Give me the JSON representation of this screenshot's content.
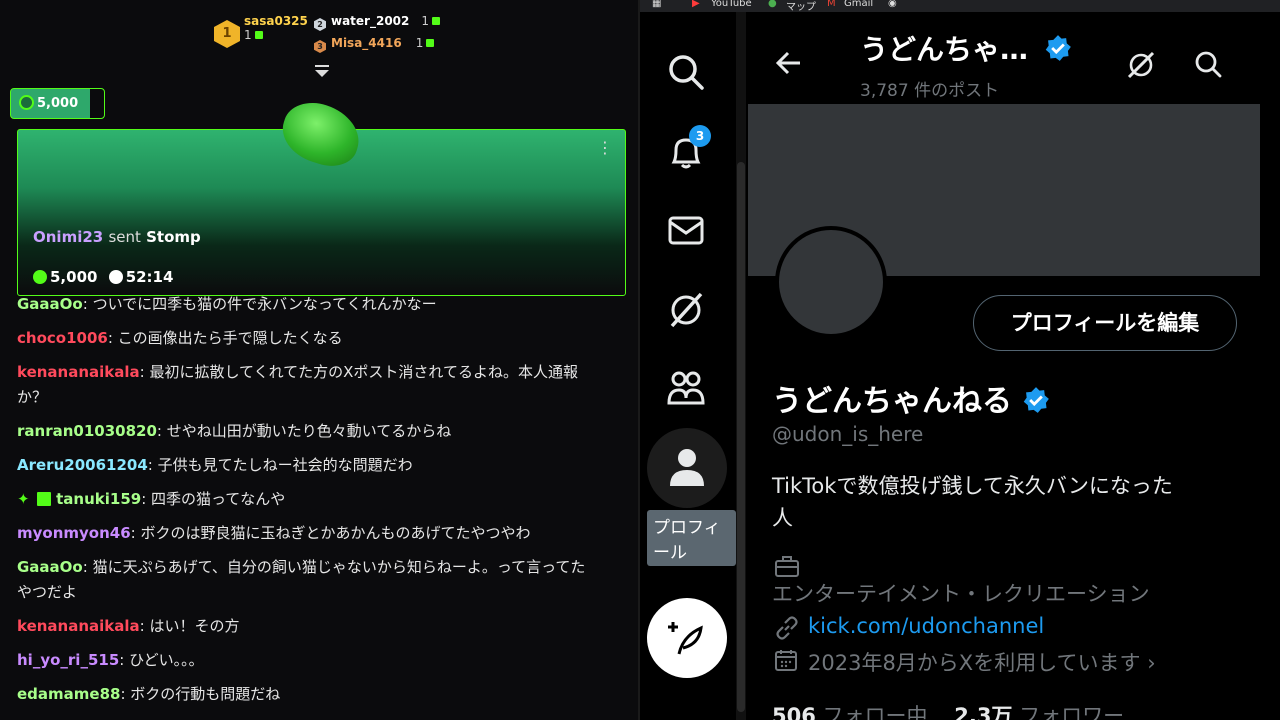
{
  "leaderboard": [
    {
      "rank": "1",
      "name": "sasa0325",
      "count": "1"
    },
    {
      "rank": "2",
      "name": "water_2002",
      "count": "1"
    },
    {
      "rank": "3",
      "name": "Misa_4416",
      "count": "1"
    }
  ],
  "goal_pill": {
    "value": "5,000"
  },
  "gift_card": {
    "user": "Onimi23",
    "verb": "sent",
    "item": "Stomp",
    "amount": "5,000",
    "timer": "52:14"
  },
  "chat": [
    {
      "user": "GaaaOo",
      "color": "#a8ff8a",
      "text": "ついでに四季も猫の件で永バンなってくれんかなー"
    },
    {
      "user": "choco1006",
      "color": "#ff4a5c",
      "text": "この画像出たら手で隠したくなる"
    },
    {
      "user": "kenananaikala",
      "color": "#ff4a5c",
      "text": "最初に拡散してくれてた方のXポスト消されてるよね。本人通報",
      "text2": "か？"
    },
    {
      "user": "ranran01030820",
      "color": "#a8ff8a",
      "text": "せやね山田が動いたり色々動いてるからね"
    },
    {
      "user": "Areru20061204",
      "color": "#8ae8ff",
      "text": "子供も見てたしねー社会的な問題だわ"
    },
    {
      "user": "tanuki159",
      "color": "#a8ff8a",
      "text": "四季の猫ってなんや"
    },
    {
      "user": "myonmyon46",
      "color": "#c98bff",
      "text": "ボクのは野良猫に玉ねぎとかあかんものあげてたやつやわ"
    },
    {
      "user": "GaaaOo",
      "color": "#a8ff8a",
      "text": "猫に天ぷらあげて、自分の飼い猫じゃないから知らねーよ。って言ってた",
      "text2": "やつだよ"
    },
    {
      "user": "kenananaikala",
      "color": "#ff4a5c",
      "text": "はい！その方"
    },
    {
      "user": "hi_yo_ri_515",
      "color": "#c98bff",
      "text": "ひどい。。。"
    },
    {
      "user": "edamame88",
      "color": "#a8ff8a",
      "text": "ボクの行動も問題だね"
    }
  ],
  "browser": {
    "bookmarks": [
      "YouTube",
      "マップ",
      "Gmail"
    ]
  },
  "x": {
    "notifications_count": "3",
    "tooltip": "プロフィール",
    "header_title": "うどんちゃ…",
    "header_posts": "3,787 件のポスト",
    "edit_button": "プロフィールを編集",
    "name": "うどんちゃんねる",
    "handle": "@udon_is_here",
    "bio_line1": "TikTokで数億投げ銭して永久バンになった",
    "bio_line2": "人",
    "category": "エンターテイメント・レクリエーション",
    "link": "kick.com/udonchannel",
    "joined": "2023年8月からXを利用しています",
    "following_count": "506",
    "following_label": "フォロー中",
    "followers_count": "2.3万",
    "followers_label": "フォロワー",
    "accent": "#1d9bf0"
  }
}
